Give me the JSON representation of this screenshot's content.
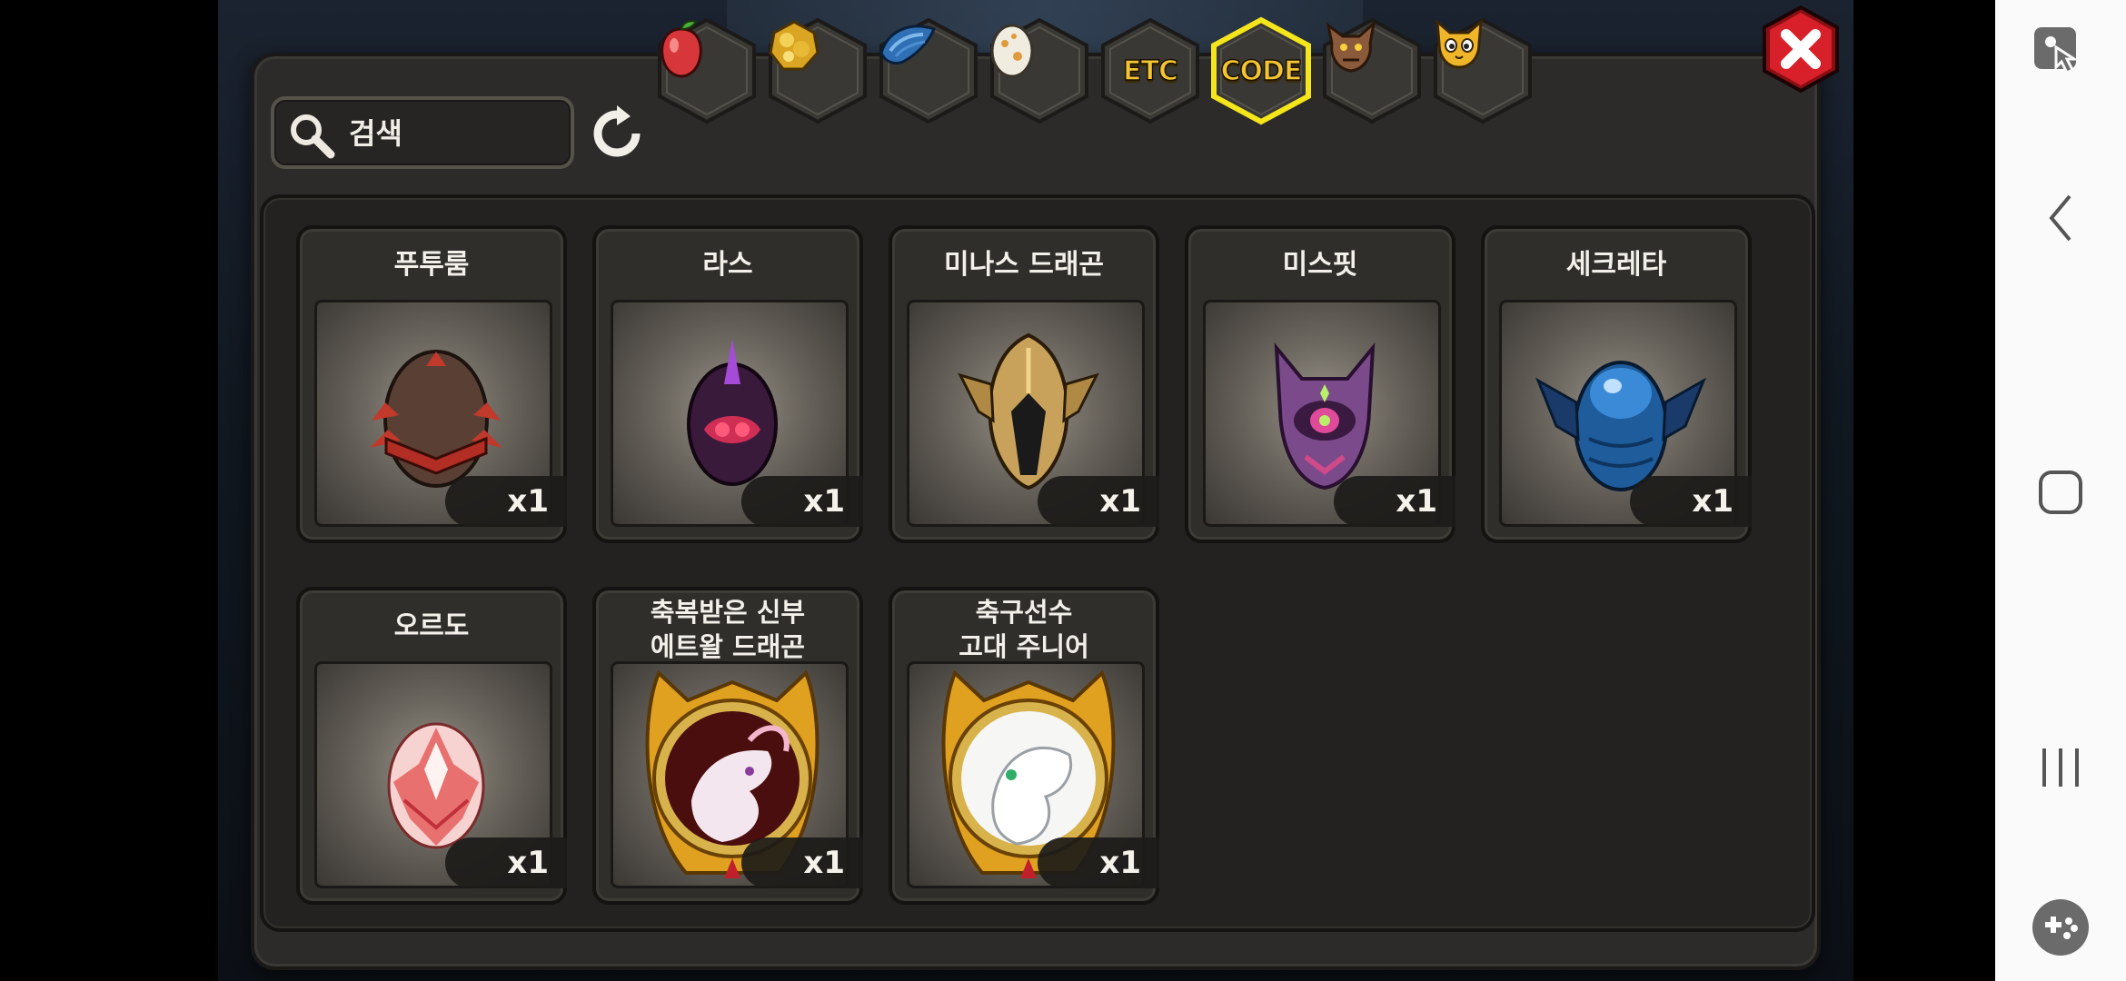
{
  "tabs": [
    {
      "name": "tab-fruit",
      "icon": "fruit-icon",
      "label": ""
    },
    {
      "name": "tab-gold",
      "icon": "gold-ore-icon",
      "label": ""
    },
    {
      "name": "tab-dragon-scale",
      "icon": "dragon-scale-icon",
      "label": ""
    },
    {
      "name": "tab-egg",
      "icon": "egg-icon",
      "label": ""
    },
    {
      "name": "tab-etc",
      "icon": "",
      "label": "ETC"
    },
    {
      "name": "tab-code",
      "icon": "",
      "label": "CODE",
      "selected": true
    },
    {
      "name": "tab-monster",
      "icon": "monster-head-icon",
      "label": ""
    },
    {
      "name": "tab-cat",
      "icon": "cat-face-icon",
      "label": ""
    }
  ],
  "search": {
    "placeholder": "검색"
  },
  "items": [
    {
      "name": "푸투룸",
      "count": "x1",
      "icon": "futurum-egg-icon"
    },
    {
      "name": "라스",
      "count": "x1",
      "icon": "ras-egg-icon"
    },
    {
      "name": "미나스 드래곤",
      "count": "x1",
      "icon": "minas-dragon-helm-icon"
    },
    {
      "name": "미스핏",
      "count": "x1",
      "icon": "misfit-egg-icon"
    },
    {
      "name": "세크레타",
      "count": "x1",
      "icon": "secreta-egg-icon"
    },
    {
      "name": "오르도",
      "count": "x1",
      "icon": "ordo-egg-icon"
    },
    {
      "name": "축복받은 신부\n에트왈 드래곤",
      "count": "x1",
      "icon": "blessed-bride-dragon-emblem-icon"
    },
    {
      "name": "축구선수\n고대 주니어",
      "count": "x1",
      "icon": "football-player-dragon-emblem-icon"
    }
  ],
  "colors": {
    "accent": "#f4c533",
    "selected_tab_glow": "#f5e51b",
    "close_red": "#d8202a",
    "panel": "#2c2b29"
  }
}
